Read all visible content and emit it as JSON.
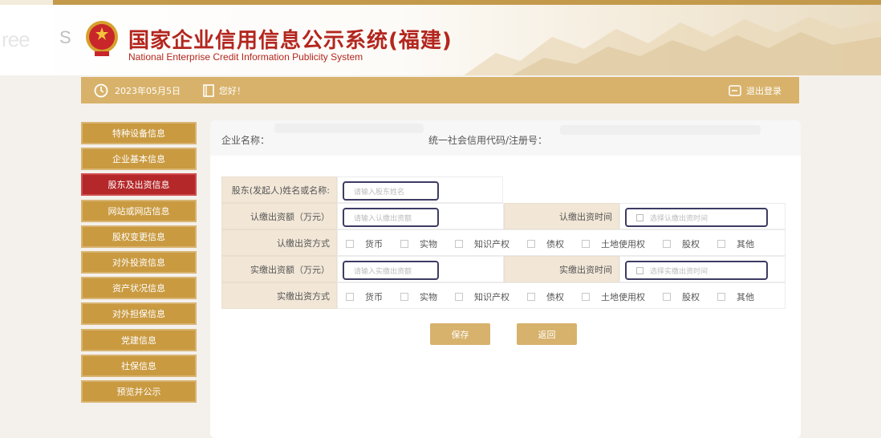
{
  "header": {
    "title_cn": "国家企业信用信息公示系统(福建)",
    "title_en": "National Enterprise Credit Information Publicity System",
    "watermark": "ree",
    "watermark_extra": "S"
  },
  "infobar": {
    "date": "2023年05月5日",
    "greeting": "您好！",
    "logout_label": "退出登录"
  },
  "sidebar": {
    "items": [
      {
        "label": "特种设备信息",
        "active": false
      },
      {
        "label": "企业基本信息",
        "active": false
      },
      {
        "label": "股东及出资信息",
        "active": true
      },
      {
        "label": "网站或网店信息",
        "active": false
      },
      {
        "label": "股权变更信息",
        "active": false
      },
      {
        "label": "对外投资信息",
        "active": false
      },
      {
        "label": "资产状况信息",
        "active": false
      },
      {
        "label": "对外担保信息",
        "active": false
      },
      {
        "label": "党建信息",
        "active": false
      },
      {
        "label": "社保信息",
        "active": false
      },
      {
        "label": "预览并公示",
        "active": false
      }
    ]
  },
  "main": {
    "name_label": "企业名称：",
    "code_label": "统一社会信用代码/注册号：",
    "form": {
      "shareholder_label": "股东(发起人)姓名或名称:",
      "shareholder_placeholder": "请输入股东姓名",
      "subscribed_amount_label": "认缴出资额（万元）",
      "subscribed_amount_placeholder": "请输入认缴出资额",
      "subscribed_date_label": "认缴出资时间",
      "subscribed_date_placeholder": "选择认缴出资时间",
      "subscribed_method_label": "认缴出资方式",
      "paid_amount_label": "实缴出资额（万元）",
      "paid_amount_placeholder": "请输入实缴出资额",
      "paid_date_label": "实缴出资时间",
      "paid_date_placeholder": "选择实缴出资时间",
      "paid_method_label": "实缴出资方式",
      "methods": [
        "货币",
        "实物",
        "知识产权",
        "债权",
        "土地使用权",
        "股权",
        "其他"
      ]
    },
    "save_label": "保存",
    "back_label": "返回"
  }
}
